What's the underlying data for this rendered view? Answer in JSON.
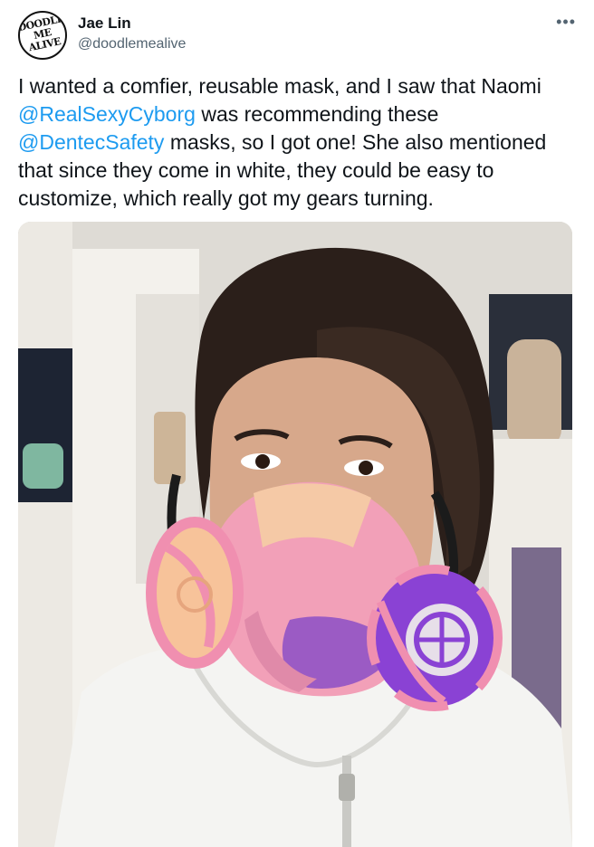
{
  "author": {
    "name": "Jae Lin",
    "handle": "@doodlemealive",
    "avatar_text": [
      "DOODLE",
      "ME",
      "ALIVE"
    ]
  },
  "menu_icon": "more-horizontal-icon",
  "tweet": {
    "segments": [
      {
        "type": "text",
        "text": "I wanted a comfier, reusable mask, and I saw that Naomi "
      },
      {
        "type": "mention",
        "text": "@RealSexyCyborg"
      },
      {
        "type": "text",
        "text": " was recommending these "
      },
      {
        "type": "mention",
        "text": "@DentecSafety"
      },
      {
        "type": "text",
        "text": " masks, so I got one! She also mentioned that since they come in white, they could be easy to customize, which really got my gears turning."
      }
    ]
  },
  "colors": {
    "mention": "#1d9bf0",
    "text": "#0f1419",
    "secondary": "#536471"
  }
}
